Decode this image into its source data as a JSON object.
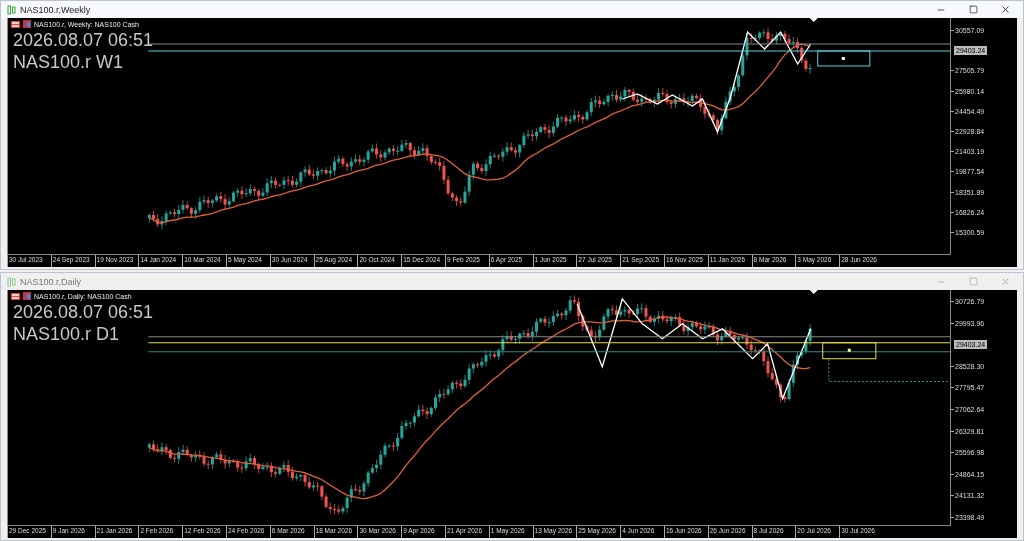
{
  "windows": [
    {
      "title": "NAS100.r,Weekly",
      "active": true,
      "chart_header": "NAS100.r, Weekly:  NAS100 Cash",
      "clock": "2026.08.07 06:51",
      "symbol_period": "NAS100.r W1",
      "price_tag": "29403.24",
      "y_ticks": [
        "30557.09",
        "27505.79",
        "25980.14",
        "24454.49",
        "22928.84",
        "21403.19",
        "19877.54",
        "18351.89",
        "16826.24",
        "15300.59"
      ],
      "x_ticks": [
        "30 Jul 2023",
        "24 Sep 2023",
        "19 Nov 2023",
        "14 Jan 2024",
        "10 Mar 2024",
        "5 May 2024",
        "30 Jun 2024",
        "25 Aug 2024",
        "20 Oct 2024",
        "15 Dec 2024",
        "9 Feb 2025",
        "6 Apr 2025",
        "1 Jun 2025",
        "27 Jul 2025",
        "21 Sep 2025",
        "16 Nov 2025",
        "11 Jan 2026",
        "8 Mar 2026",
        "3 May 2026",
        "28 Jun 2026"
      ]
    },
    {
      "title": "NAS100.r,Daily",
      "active": false,
      "chart_header": "NAS100.r, Daily:  NAS100 Cash",
      "clock": "2026.08.07 06:51",
      "symbol_period": "NAS100.r D1",
      "price_tag": "29403.24",
      "y_ticks": [
        "30726.79",
        "29993.96",
        "28528.30",
        "27795.47",
        "27062.64",
        "26329.81",
        "25596.98",
        "24864.15",
        "24131.32",
        "23398.49"
      ],
      "x_ticks": [
        "29 Dec 2025",
        "9 Jan 2026",
        "21 Jan 2026",
        "2 Feb 2026",
        "12 Feb 2026",
        "24 Feb 2026",
        "6 Mar 2026",
        "18 Mar 2026",
        "30 Mar 2026",
        "9 Apr 2026",
        "21 Apr 2026",
        "1 May 2026",
        "13 May 2026",
        "25 May 2026",
        "4 Jun 2026",
        "16 Jun 2026",
        "26 Jun 2026",
        "8 Jul 2026",
        "20 Jul 2026",
        "30 Jul 2026"
      ]
    }
  ]
}
